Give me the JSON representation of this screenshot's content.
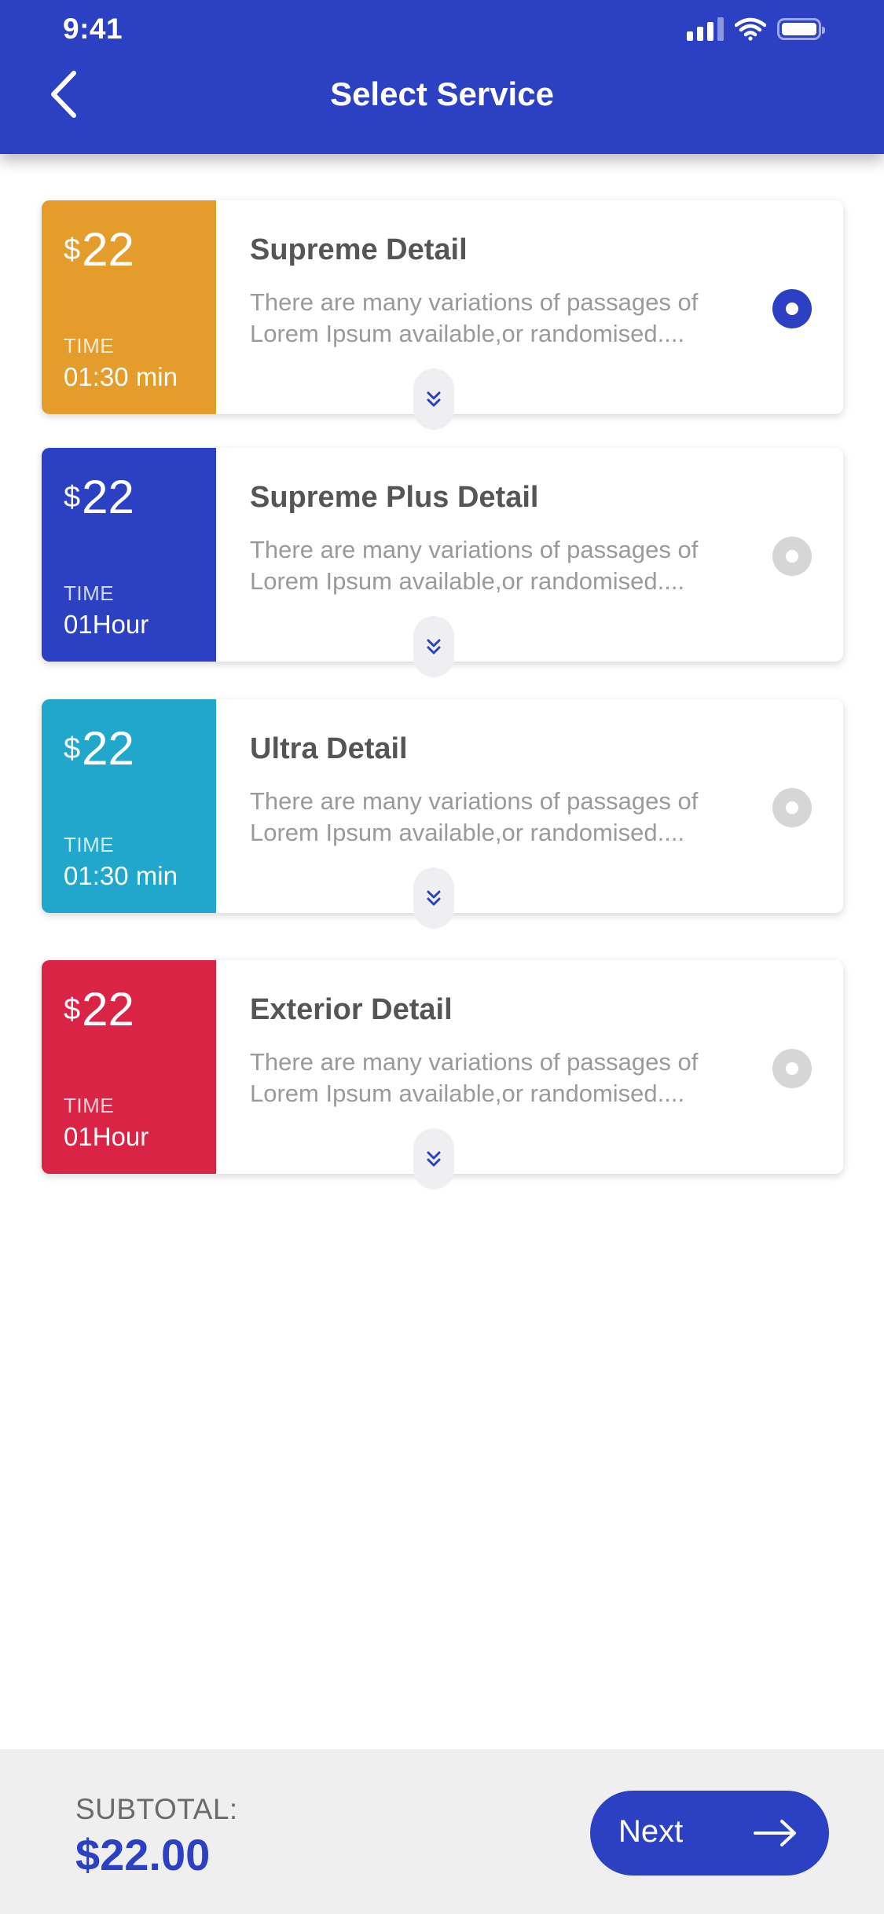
{
  "status_bar": {
    "time": "9:41"
  },
  "header": {
    "title": "Select Service"
  },
  "colors": {
    "primary": "#2b40c3",
    "orange": "#e49d2b",
    "blue": "#2b40c3",
    "cyan": "#21a7cc",
    "red": "#da2446"
  },
  "services": [
    {
      "currency": "$",
      "price": "22",
      "time_label": "TIME",
      "time": "01:30 min",
      "name": "Supreme Detail",
      "description": "There are many variations of passages of Lorem Ipsum available,or randomised....",
      "color": "#e49d2b",
      "selected": true
    },
    {
      "currency": "$",
      "price": "22",
      "time_label": "TIME",
      "time": "01Hour",
      "name": "Supreme Plus Detail",
      "description": "There are many variations of passages of Lorem Ipsum available,or randomised....",
      "color": "#2b40c3",
      "selected": false
    },
    {
      "currency": "$",
      "price": "22",
      "time_label": "TIME",
      "time": "01:30 min",
      "name": "Ultra Detail",
      "description": "There are many variations of passages of Lorem Ipsum available,or randomised....",
      "color": "#21a7cc",
      "selected": false
    },
    {
      "currency": "$",
      "price": "22",
      "time_label": "TIME",
      "time": "01Hour",
      "name": "Exterior Detail",
      "description": "There are many variations of passages of Lorem Ipsum available,or randomised....",
      "color": "#da2446",
      "selected": false
    }
  ],
  "footer": {
    "subtotal_label": "SUBTOTAL:",
    "subtotal_value": "$22.00",
    "next_label": "Next"
  },
  "icons": {
    "back": "chevron-left-icon",
    "expand": "double-chevron-down-icon",
    "next": "arrow-right-icon"
  }
}
